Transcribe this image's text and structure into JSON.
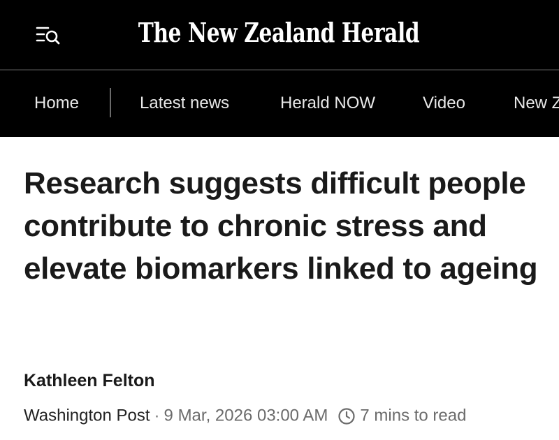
{
  "header": {
    "logo": "The New Zealand Herald",
    "menu_icon": "menu-search-icon"
  },
  "nav": {
    "items": [
      {
        "label": "Home"
      },
      {
        "label": "Latest news"
      },
      {
        "label": "Herald NOW"
      },
      {
        "label": "Video"
      },
      {
        "label": "New Z"
      }
    ]
  },
  "article": {
    "headline": "Research suggests difficult people contribute to chronic stress and elevate biomarkers linked to ageing",
    "author": "Kathleen Felton",
    "source": "Washington Post",
    "separator": "·",
    "date": "9 Mar, 2026 03:00 AM",
    "read_icon": "clock-icon",
    "read_time": "7 mins to read"
  },
  "colors": {
    "header_bg": "#000000",
    "nav_text": "#e8e8e8",
    "headline": "#1a1a1a",
    "meta_grey": "#6b6b6b"
  }
}
